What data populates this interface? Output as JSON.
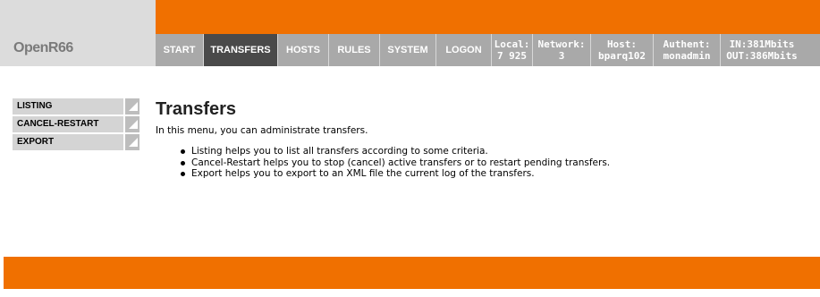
{
  "app": {
    "logo": "OpenR66"
  },
  "nav": {
    "items": [
      {
        "label": "START"
      },
      {
        "label": "TRANSFERS",
        "active": true
      },
      {
        "label": "HOSTS"
      },
      {
        "label": "RULES"
      },
      {
        "label": "SYSTEM"
      },
      {
        "label": "LOGON"
      }
    ],
    "stats": {
      "local": {
        "label": "Local:",
        "value": "7 925"
      },
      "network": {
        "label": "Network:",
        "value": "3"
      },
      "host": {
        "label": "Host:",
        "value": "bparq102"
      },
      "authent": {
        "label": "Authent:",
        "value": "monadmin"
      },
      "bandwidth": {
        "in": "IN:381Mbits",
        "out": "OUT:386Mbits"
      }
    }
  },
  "sidebar": {
    "items": [
      {
        "label": "LISTING"
      },
      {
        "label": "CANCEL-RESTART"
      },
      {
        "label": "EXPORT"
      }
    ]
  },
  "main": {
    "title": "Transfers",
    "intro": "In this menu, you can administrate transfers.",
    "help": [
      "Listing helps you to list all transfers according to some criteria.",
      "Cancel-Restart helps you to stop (cancel) active transfers or to restart pending transfers.",
      "Export helps you to export to an XML file the current log of the transfers."
    ]
  },
  "colors": {
    "orange": "#f07000",
    "nav_bg": "#a9a9a9",
    "nav_active": "#4a4a4a",
    "logo_bg": "#dcdcdc",
    "sidebar_bg": "#d4d4d4"
  }
}
